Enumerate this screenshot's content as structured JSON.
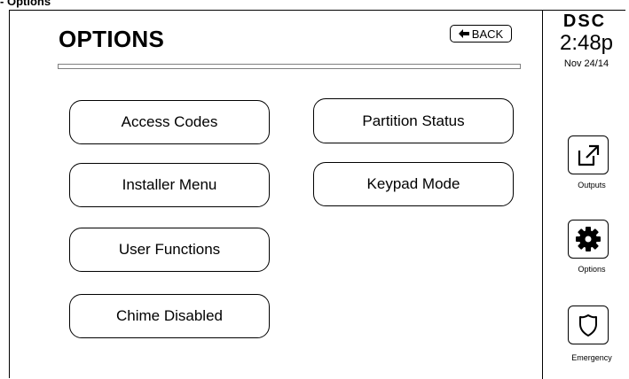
{
  "caption": "Options",
  "screen": {
    "title": "OPTIONS",
    "back_label": "BACK"
  },
  "options": [
    {
      "label": "Access Codes"
    },
    {
      "label": "Installer Menu"
    },
    {
      "label": "User Functions"
    },
    {
      "label": "Chime Disabled"
    },
    {
      "label": "Partition Status"
    },
    {
      "label": "Keypad Mode"
    }
  ],
  "sidebar": {
    "brand": "DSC",
    "time": "2:48p",
    "date": "Nov 24/14",
    "buttons": [
      {
        "label": "Outputs",
        "icon": "external-link-icon"
      },
      {
        "label": "Options",
        "icon": "gear-icon"
      },
      {
        "label": "Emergency",
        "icon": "shield-icon"
      }
    ]
  }
}
